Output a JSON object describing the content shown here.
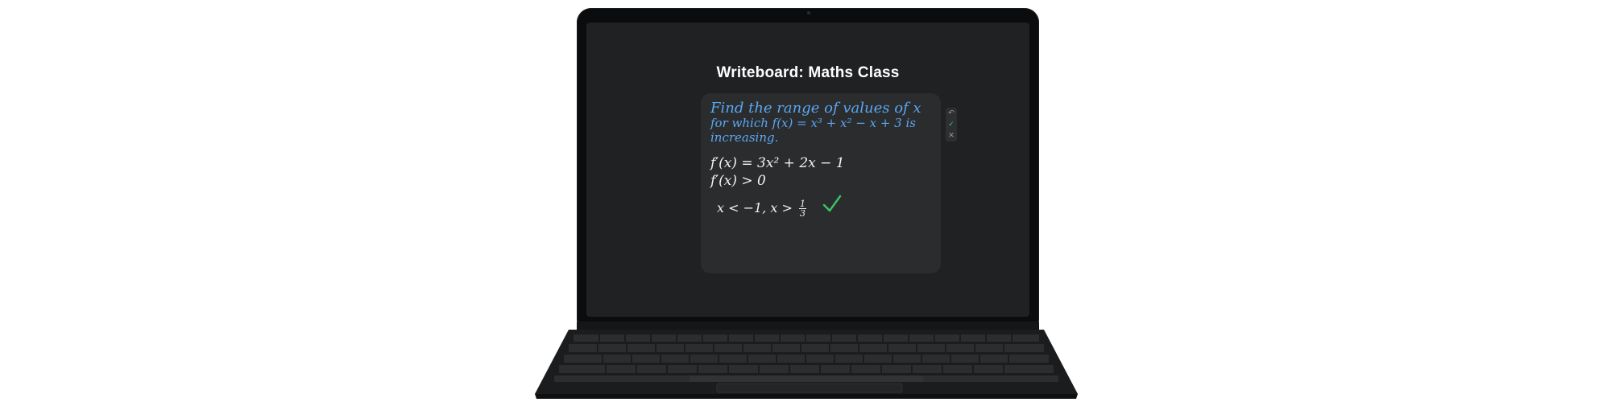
{
  "app": {
    "title": "Writeboard: Maths Class"
  },
  "board": {
    "question_line_1": "Find the range of values of x",
    "question_line_2": "for which f(x) = x³ + x² − x + 3 is",
    "question_line_3": "increasing.",
    "work_line_1": "f′(x) = 3x² + 2x − 1",
    "work_line_2": "f′(x) > 0",
    "answer_prefix": "x < −1,  x >",
    "answer_numerator": "1",
    "answer_denominator": "3",
    "check_icon": "check-icon"
  },
  "toolbar": {
    "undo_glyph": "↶",
    "accept_glyph": "✓",
    "close_glyph": "✕"
  },
  "colors": {
    "question_ink": "#5aa7f2",
    "work_ink": "#f2f2f2",
    "check_ink": "#3ac569",
    "screen_bg": "#1f2122",
    "board_bg": "#2b2c2e"
  }
}
